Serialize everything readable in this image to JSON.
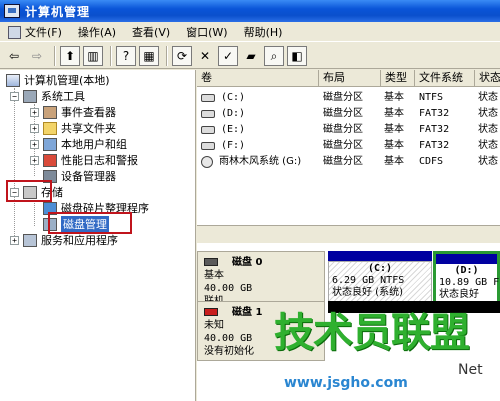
{
  "window": {
    "title": "计算机管理"
  },
  "menu": {
    "items": [
      "文件(F)",
      "操作(A)",
      "查看(V)",
      "窗口(W)",
      "帮助(H)"
    ]
  },
  "toolbar": {
    "buttons": [
      "back-arrow",
      "forward-arrow",
      "up-folder",
      "show-hide-tree",
      "help",
      "properties",
      "refresh",
      "delete",
      "check",
      "open-folder",
      "find",
      "explore"
    ]
  },
  "tree": {
    "root": "计算机管理(本地)",
    "system_tools": "系统工具",
    "event_viewer": "事件查看器",
    "shared_folders": "共享文件夹",
    "local_users": "本地用户和组",
    "perf_logs": "性能日志和警报",
    "device_manager": "设备管理器",
    "storage": "存储",
    "defrag": "磁盘碎片整理程序",
    "disk_management": "磁盘管理",
    "services": "服务和应用程序"
  },
  "volume_list": {
    "headers": [
      "卷",
      "布局",
      "类型",
      "文件系统",
      "状态"
    ],
    "rows": [
      {
        "volume": "(C:)",
        "layout": "磁盘分区",
        "type": "基本",
        "fs": "NTFS",
        "status": "状态"
      },
      {
        "volume": "(D:)",
        "layout": "磁盘分区",
        "type": "基本",
        "fs": "FAT32",
        "status": "状态"
      },
      {
        "volume": "(E:)",
        "layout": "磁盘分区",
        "type": "基本",
        "fs": "FAT32",
        "status": "状态"
      },
      {
        "volume": "(F:)",
        "layout": "磁盘分区",
        "type": "基本",
        "fs": "FAT32",
        "status": "状态"
      },
      {
        "volume": "雨林木风系统 (G:)",
        "layout": "磁盘分区",
        "type": "基本",
        "fs": "CDFS",
        "status": "状态"
      }
    ]
  },
  "disks": [
    {
      "name": "磁盘 0",
      "kind": "基本",
      "size": "40.00 GB",
      "state": "联机",
      "partitions": [
        {
          "label": "(C:)",
          "size": "6.29 GB NTFS",
          "status": "状态良好 (系统)"
        },
        {
          "label": "(D:)",
          "size": "10.89 GB F",
          "status": "状态良好"
        }
      ]
    },
    {
      "name": "磁盘 1",
      "kind": "未知",
      "size": "40.00 GB",
      "state": "没有初始化"
    }
  ],
  "watermark": {
    "title": "技术员联盟",
    "url": "www.jsgho.com",
    "suffix": "Net"
  }
}
